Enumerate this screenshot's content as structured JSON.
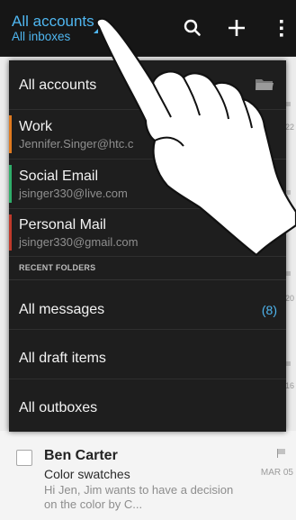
{
  "header": {
    "title": "All accounts",
    "subtitle": "All inboxes",
    "icons": [
      "search-icon",
      "plus-icon",
      "overflow-menu-icon"
    ]
  },
  "dropdown": {
    "all_accounts_label": "All accounts",
    "accounts": [
      {
        "name": "Work",
        "email": "Jennifer.Singer@htc.c",
        "color": "#e07a1f"
      },
      {
        "name": "Social Email",
        "email": "jsinger330@live.com",
        "color": "#2fae6a"
      },
      {
        "name": "Personal Mail",
        "email": "jsinger330@gmail.com",
        "color": "#c0392b"
      }
    ],
    "recent_header": "RECENT FOLDERS",
    "folders": [
      {
        "label": "All messages",
        "count": "(8)"
      },
      {
        "label": "All draft items",
        "count": ""
      },
      {
        "label": "All outboxes",
        "count": ""
      }
    ]
  },
  "background": {
    "edge_dates": [
      "22",
      "20",
      "16"
    ]
  },
  "email": {
    "sender": "Ben Carter",
    "subject": "Color swatches",
    "preview": "Hi Jen,  Jim wants to have a decision on the color by C...",
    "date": "MAR 05"
  },
  "colors": {
    "accent": "#4fb6f0",
    "header_bg": "#161616",
    "dropdown_bg": "#1e1e1e"
  }
}
